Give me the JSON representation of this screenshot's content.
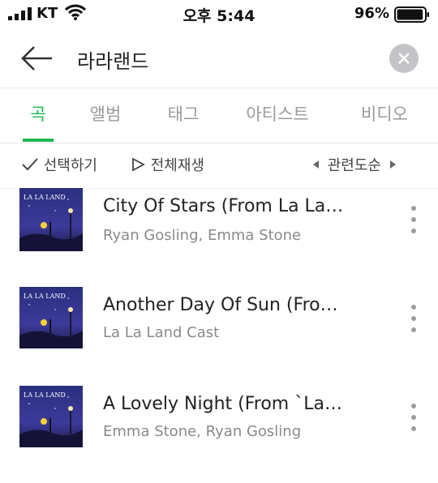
{
  "status_bar": {
    "carrier": "KT",
    "time": "오후 5:44",
    "battery_percent": "96%",
    "battery_level": 0.96,
    "icons": [
      "signal-icon",
      "wifi-icon",
      "battery-icon"
    ]
  },
  "header": {
    "back_icon": "arrow-left-icon",
    "search_query": "라라랜드",
    "clear_icon": "close-icon"
  },
  "tabs": [
    {
      "label": "곡",
      "active": true
    },
    {
      "label": "앨범",
      "active": false
    },
    {
      "label": "태그",
      "active": false
    },
    {
      "label": "아티스트",
      "active": false
    },
    {
      "label": "비디오",
      "active": false
    }
  ],
  "toolbar": {
    "select_label": "선택하기",
    "play_all_label": "전체재생",
    "sort_label": "관련도순"
  },
  "songs": [
    {
      "title": "City Of Stars (From La La…",
      "artist": "Ryan Gosling, Emma Stone",
      "album_art_text": "LA LA LAND"
    },
    {
      "title": "Another Day Of Sun (Fro…",
      "artist": "La La Land Cast",
      "album_art_text": "LA LA LAND"
    },
    {
      "title": "A Lovely Night (From `La…",
      "artist": "Emma Stone, Ryan Gosling",
      "album_art_text": "LA LA LAND"
    }
  ],
  "colors": {
    "accent": "#1db954",
    "text_primary": "#222222",
    "text_secondary": "#8a8a8a",
    "tab_inactive": "#9a9a9a"
  }
}
